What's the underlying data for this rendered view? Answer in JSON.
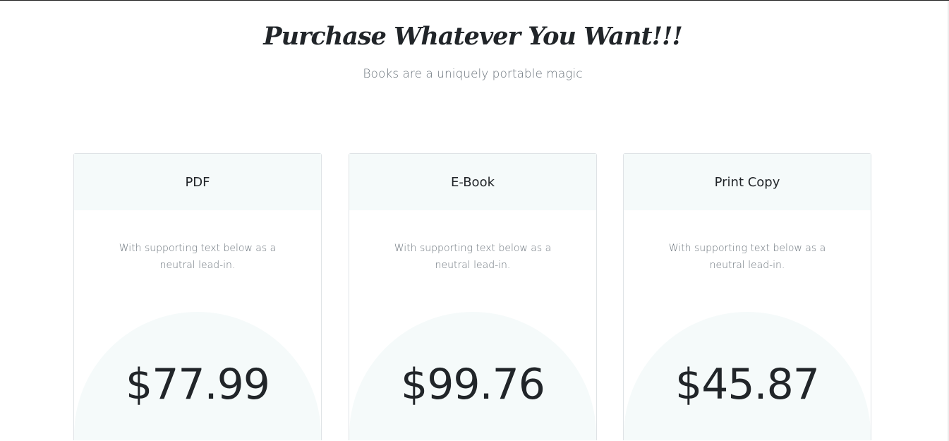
{
  "header": {
    "title": "Purchase Whatever You Want!!!",
    "subtitle": "Books are a uniquely portable magic"
  },
  "cards": [
    {
      "title": "PDF",
      "text": "With supporting text below as a neutral lead-in.",
      "price": "$77.99"
    },
    {
      "title": "E-Book",
      "text": "With supporting text below as a neutral lead-in.",
      "price": "$99.76"
    },
    {
      "title": "Print Copy",
      "text": "With supporting text below as a neutral lead-in.",
      "price": "$45.87"
    }
  ]
}
